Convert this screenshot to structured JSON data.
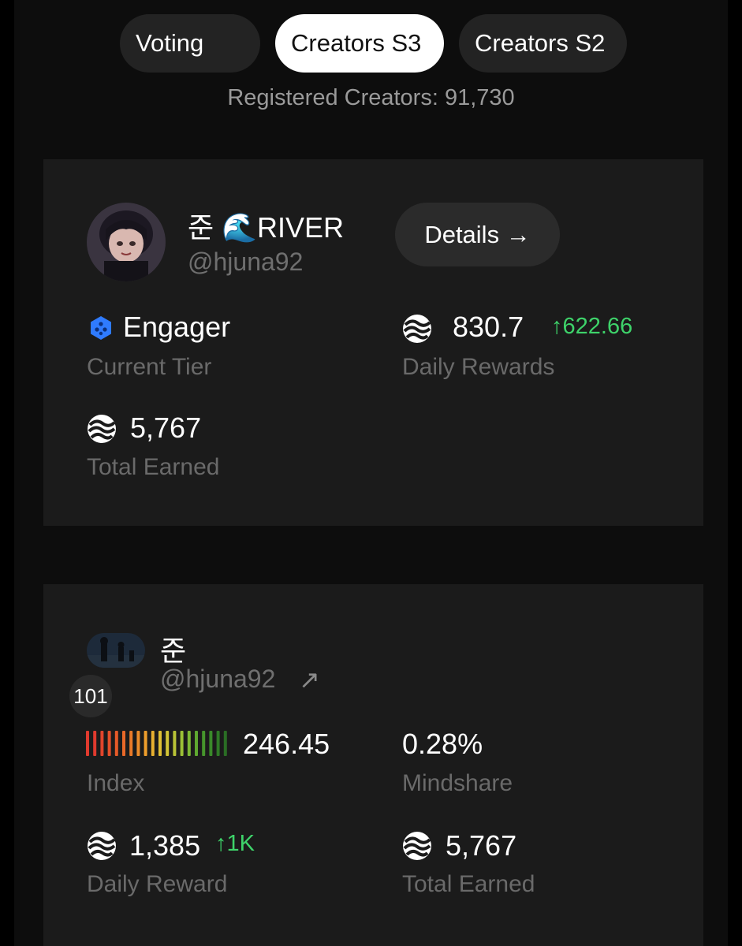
{
  "tabs": [
    {
      "label": "Voting",
      "active": false
    },
    {
      "label": "Creators S3",
      "active": true
    },
    {
      "label": "Creators S2",
      "active": false
    }
  ],
  "registered_text": "Registered Creators: 91,730",
  "profile_card": {
    "name": "준 🌊RIVER",
    "handle": "@hjuna92",
    "details_label": "Details →",
    "tier_value": "Engager",
    "tier_label": "Current Tier",
    "daily_rewards_value": "830.7",
    "daily_rewards_delta": "↑622.66",
    "daily_rewards_label": "Daily Rewards",
    "total_earned_value": "5,767",
    "total_earned_label": "Total Earned"
  },
  "creator_card": {
    "name": "준",
    "handle": "@hjuna92",
    "link_icon": "↗",
    "rank": "101",
    "index_value": "246.45",
    "index_label": "Index",
    "mindshare_value": "0.28%",
    "mindshare_label": "Mindshare",
    "daily_reward_value": "1,385",
    "daily_reward_delta": "↑1K",
    "daily_reward_label": "Daily Reward",
    "total_earned_value": "5,767",
    "total_earned_label": "Total Earned",
    "index_meter_colors": [
      "#e03a2e",
      "#e03a2e",
      "#e2452c",
      "#e4502a",
      "#e65a28",
      "#e86828",
      "#ea7a28",
      "#ec8c2a",
      "#ee9e2c",
      "#e8b030",
      "#e0c034",
      "#d2c436",
      "#b8c236",
      "#9cc036",
      "#7eb834",
      "#5ea830",
      "#46962c",
      "#3a8a2a",
      "#2f7a26",
      "#2a6e24"
    ]
  },
  "colors": {
    "accent_green": "#3ed36a",
    "tier_icon": "#2f7bff"
  }
}
